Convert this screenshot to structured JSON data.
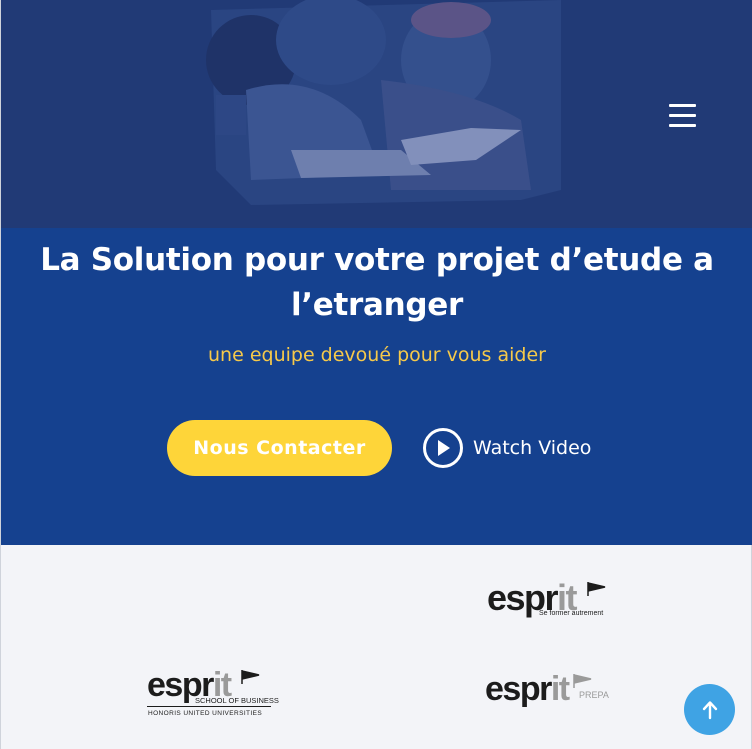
{
  "hero": {
    "title": "La Solution pour votre projet d’etude a l’etranger",
    "subtitle": "une equipe devoué pour vous aider",
    "contact_button_label": "Nous Contacter",
    "watch_video_label": "Watch Video"
  },
  "nav": {
    "menu_icon": "hamburger-icon"
  },
  "partners": {
    "esprit_main": {
      "word_start": "espr",
      "word_end": "it",
      "tagline": "Se former autrement"
    },
    "esprit_business": {
      "word_start": "espr",
      "word_end": "it",
      "line1": "SCHOOL OF BUSINESS",
      "line2": "HONORIS UNITED UNIVERSITIES"
    },
    "esprit_prepa": {
      "word_start": "espr",
      "word_end": "it",
      "suffix": "PREPA"
    }
  },
  "scroll_top": {
    "icon": "arrow-up-icon"
  },
  "colors": {
    "hero_bg": "#15418f",
    "accent_yellow": "#fed539",
    "subtitle_yellow": "#f6c94a",
    "scroll_button": "#3fa3e4"
  }
}
